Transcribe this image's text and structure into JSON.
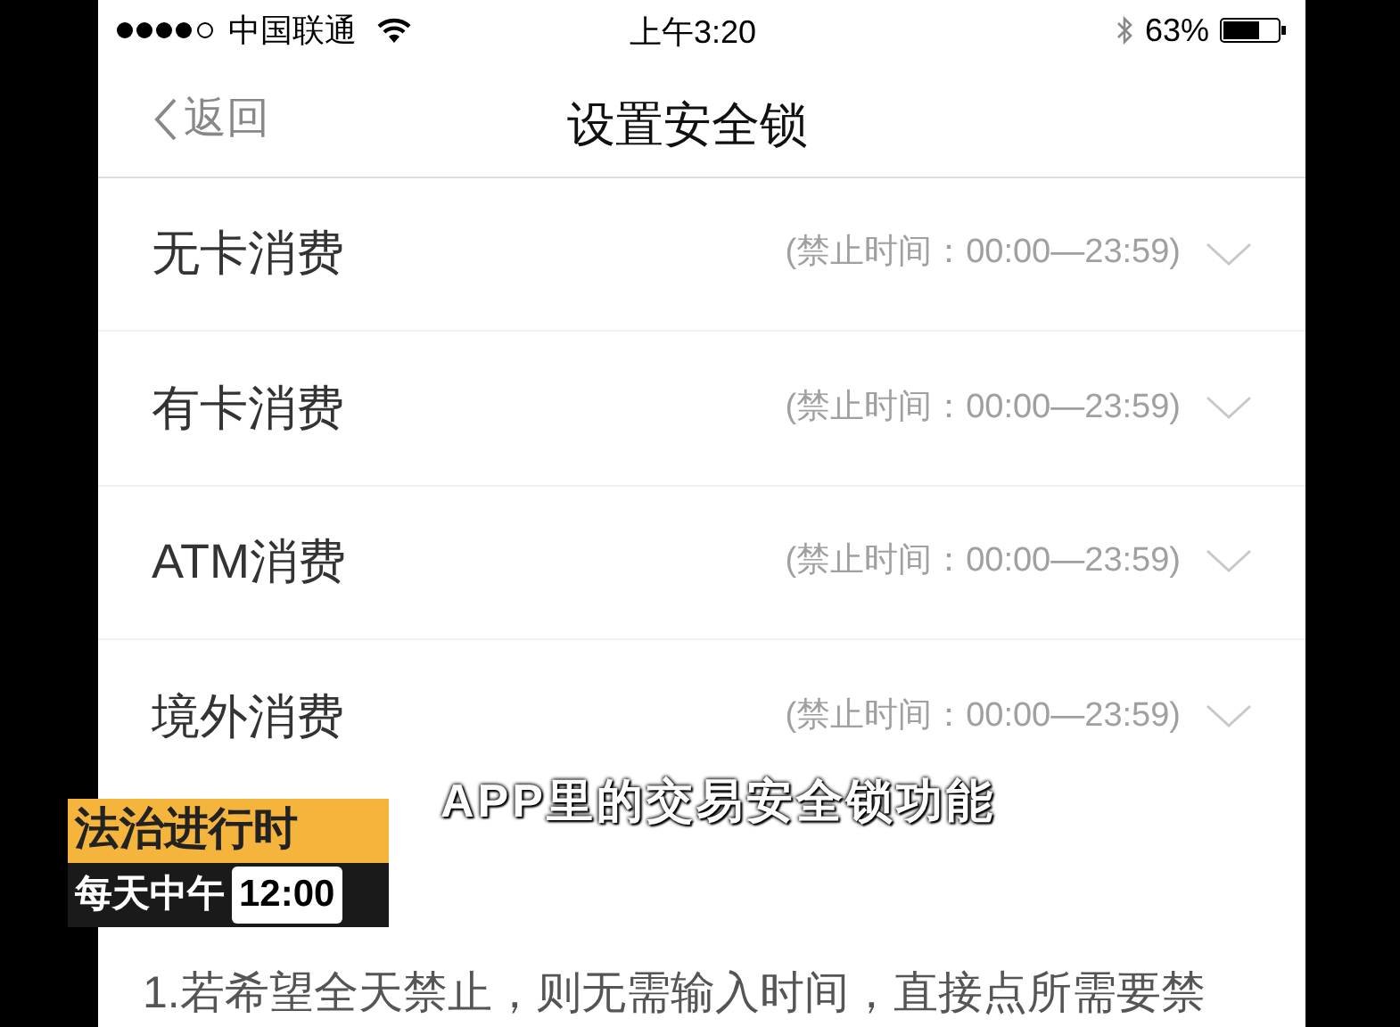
{
  "status_bar": {
    "carrier": "中国联通",
    "time": "上午3:20",
    "battery": "63%"
  },
  "nav": {
    "back": "返回",
    "title": "设置安全锁"
  },
  "rows": [
    {
      "label": "无卡消费",
      "range": "(禁止时间：00:00—23:59)"
    },
    {
      "label": "有卡消费",
      "range": "(禁止时间：00:00—23:59)"
    },
    {
      "label": "ATM消费",
      "range": "(禁止时间：00:00—23:59)"
    },
    {
      "label": "境外消费",
      "range": "(禁止时间：00:00—23:59)"
    }
  ],
  "note": "1.若希望全天禁止，则无需输入时间，直接点所需要禁",
  "caption": "APP里的交易安全锁功能",
  "program_logo": {
    "title": "法治进行时",
    "schedule": "每天中午",
    "time": "12:00"
  }
}
